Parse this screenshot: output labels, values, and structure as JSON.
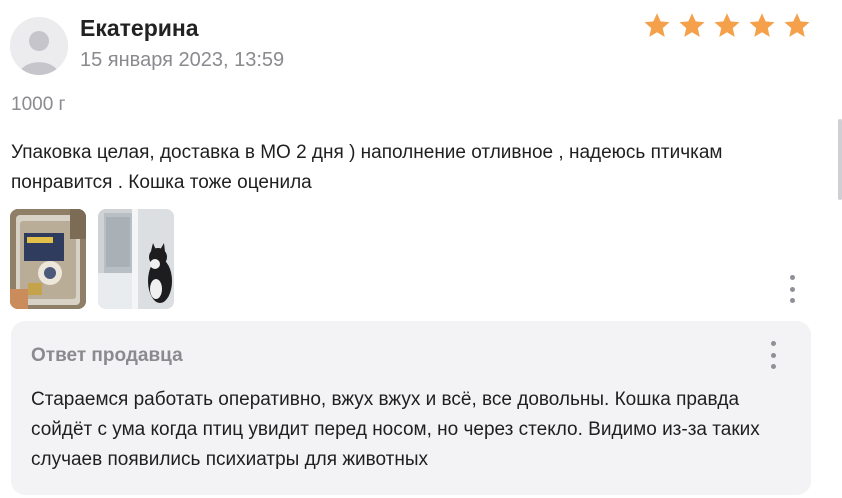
{
  "review": {
    "author": "Екатерина",
    "date": "15 января 2023, 13:59",
    "rating": 5,
    "rating_max": 5,
    "star_color": "#f5a04a",
    "variant": "1000 г",
    "text": "Упаковка целая, доставка в МО 2 дня ) наполнение отливное , надеюсь птичкам понравится . Кошка тоже оценила",
    "photos": [
      "photo-bird-food-package",
      "photo-cat-at-window"
    ]
  },
  "seller_reply": {
    "title": "Ответ продавца",
    "text": "Стараемся работать оперативно, вжух вжух и всё, все довольны. Кошка правда сойдёт с ума когда птиц увидит перед носом, но через стекло. Видимо из-за таких случаев появились психиатры для животных"
  },
  "icons": {
    "avatar": "user-avatar-icon",
    "star": "star-icon",
    "more": "more-vertical-icon"
  }
}
